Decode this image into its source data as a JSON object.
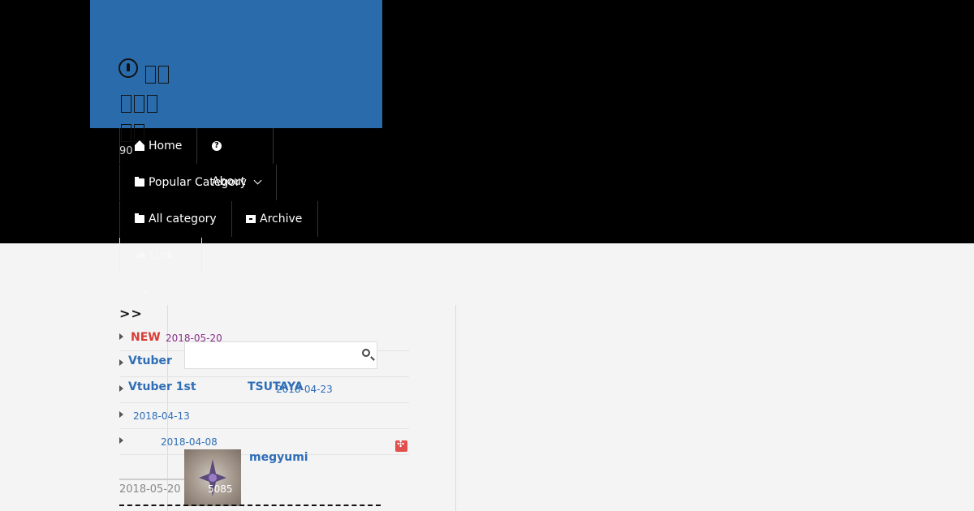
{
  "site": {
    "title_glyphs": [
      2,
      3,
      2
    ],
    "post_count": "90"
  },
  "nav": {
    "home": "Home",
    "about": "About",
    "popular": "Popular Category",
    "all_category": "All category",
    "archive": "Archive",
    "link": "Link"
  },
  "breadcrumb": ">>",
  "list": [
    {
      "badge": "NEW",
      "date": "2018-05-20"
    },
    {
      "title": "Vtuber"
    },
    {
      "title": "Vtuber 1st",
      "title2": "TSUTAYA",
      "date": "2018-04-23"
    },
    {
      "date": "2018-04-13"
    },
    {
      "date": "2018-04-08"
    }
  ],
  "search": {
    "placeholder": ""
  },
  "post": {
    "author": "megyumi",
    "date": "2018-05-20",
    "views": "5085",
    "views_prefix": "5"
  },
  "colors": {
    "header_blue": "#2a6cab",
    "link_blue": "#2f6eb6",
    "new_red": "#d93b36",
    "date_purple": "#8a2e8a"
  }
}
